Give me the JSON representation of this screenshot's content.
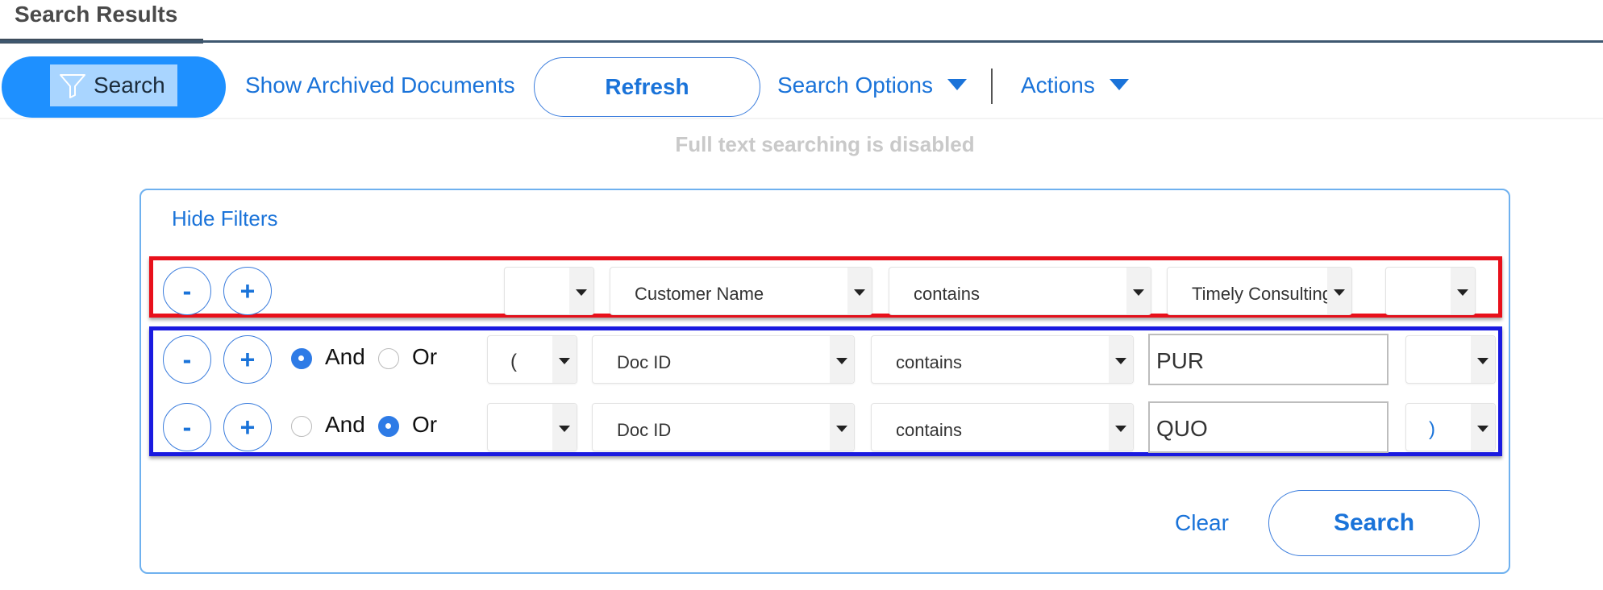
{
  "header": {
    "title": "Search Results"
  },
  "toolbar": {
    "search_label": "Search",
    "show_archived_label": "Show Archived Documents",
    "refresh_label": "Refresh",
    "search_options_label": "Search Options",
    "actions_label": "Actions"
  },
  "notice": "Full text searching is disabled",
  "filters": {
    "hide_filters_label": "Hide Filters",
    "minus_label": "-",
    "plus_label": "+",
    "and_label": "And",
    "or_label": "Or",
    "rows": [
      {
        "open_paren": "",
        "field": "Customer Name",
        "operator": "contains",
        "value": "Timely Consulting",
        "close_paren": "",
        "connector": null
      },
      {
        "open_paren": "(",
        "field": "Doc ID",
        "operator": "contains",
        "value": "PUR",
        "close_paren": "",
        "connector": "And"
      },
      {
        "open_paren": "",
        "field": "Doc ID",
        "operator": "contains",
        "value": "QUO",
        "close_paren": ")",
        "connector": "Or"
      }
    ],
    "clear_label": "Clear",
    "search_label": "Search"
  },
  "colors": {
    "accent": "#1a73d9",
    "search_pill": "#1e90ff",
    "highlight_red": "#e8101b",
    "highlight_blue": "#1a1ae0"
  },
  "icons": {
    "search": "filter-funnel-icon",
    "dropdown": "caret-down-icon"
  }
}
